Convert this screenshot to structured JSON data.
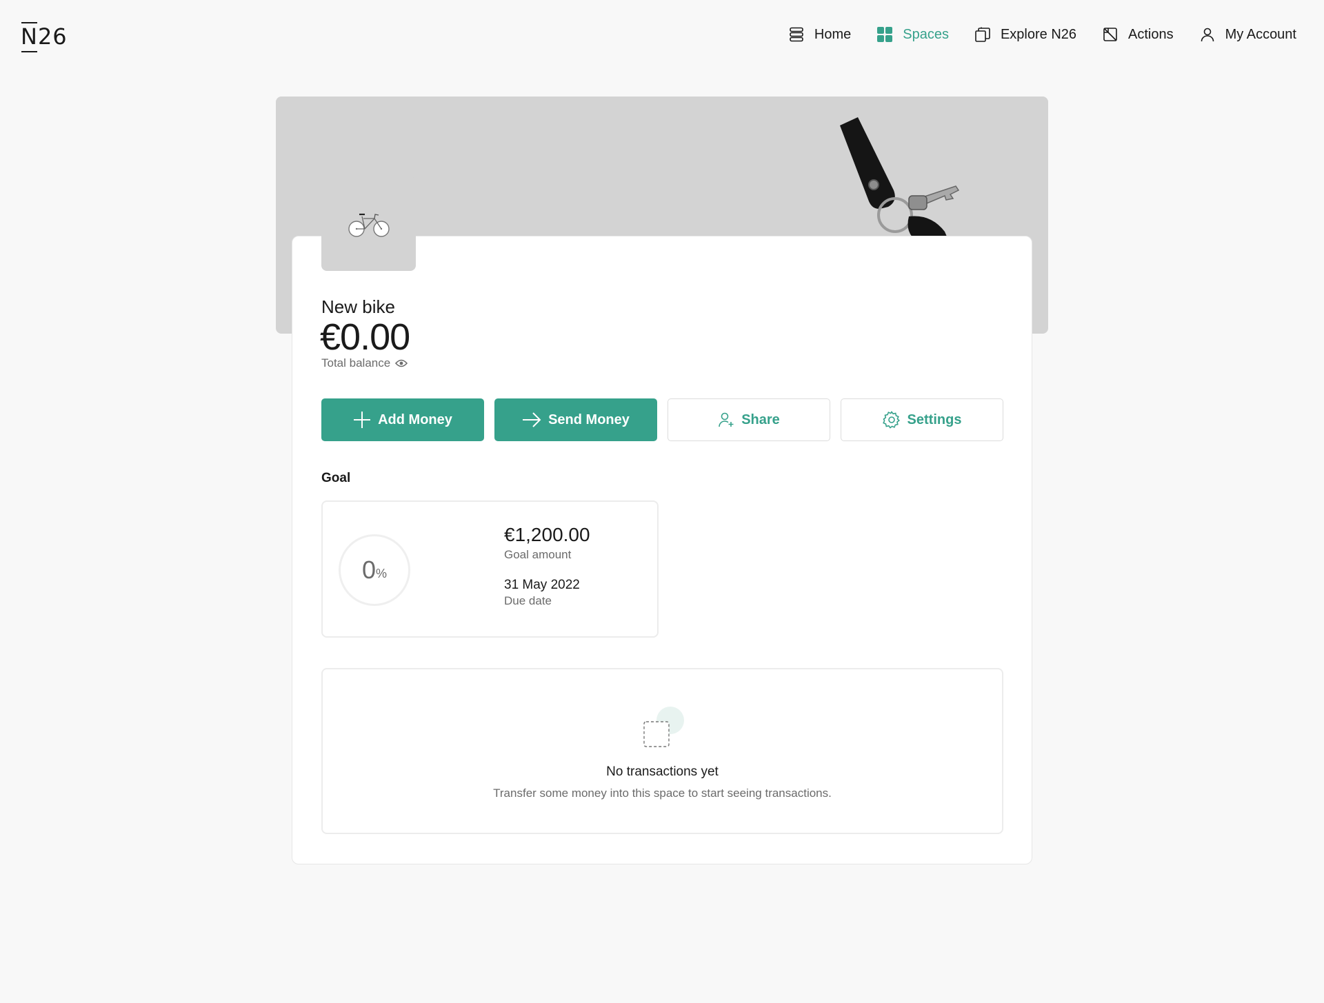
{
  "brand": {
    "logo_n": "N",
    "logo_rest": "26",
    "accent": "#36a18b"
  },
  "nav": {
    "items": [
      {
        "label": "Home",
        "icon": "home-icon",
        "active": false
      },
      {
        "label": "Spaces",
        "icon": "spaces-icon",
        "active": true
      },
      {
        "label": "Explore N26",
        "icon": "explore-icon",
        "active": false
      },
      {
        "label": "Actions",
        "icon": "actions-icon",
        "active": false
      },
      {
        "label": "My Account",
        "icon": "account-icon",
        "active": false
      }
    ]
  },
  "space": {
    "name": "New bike",
    "balance": "€0.00",
    "balance_label": "Total balance",
    "thumbnail_icon": "bicycle-icon",
    "hero_icon": "keys-icon"
  },
  "actions": {
    "add_money": "Add Money",
    "send_money": "Send Money",
    "share": "Share",
    "settings": "Settings"
  },
  "goal": {
    "heading": "Goal",
    "progress_value": "0",
    "progress_unit": "%",
    "progress_fraction": 0,
    "amount": "€1,200.00",
    "amount_label": "Goal amount",
    "due_date": "31 May 2022",
    "due_date_label": "Due date"
  },
  "transactions": {
    "empty_title": "No transactions yet",
    "empty_text": "Transfer some money into this space to start seeing transactions."
  }
}
